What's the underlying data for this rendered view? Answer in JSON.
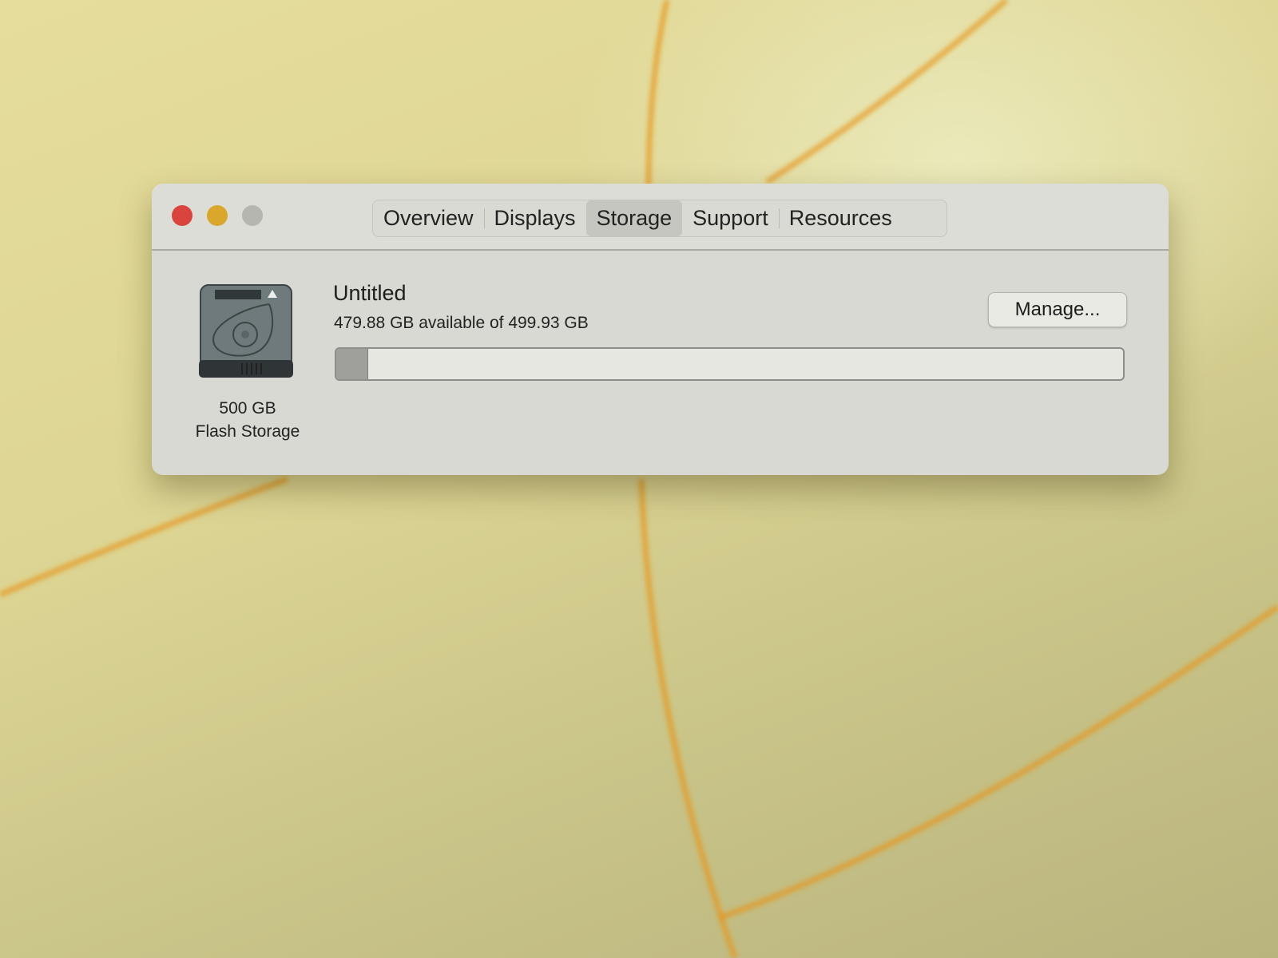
{
  "window": {
    "tabs": [
      {
        "label": "Overview"
      },
      {
        "label": "Displays"
      },
      {
        "label": "Storage",
        "active": true
      },
      {
        "label": "Support"
      },
      {
        "label": "Resources"
      }
    ],
    "disk": {
      "size_label": "500 GB",
      "type_label": "Flash Storage",
      "volume_name": "Untitled",
      "availability": "479.88 GB available of 499.93 GB",
      "used_percent": 4.0,
      "manage_label": "Manage..."
    }
  },
  "colors": {
    "close": "#d9443f",
    "minimize": "#dba62c",
    "zoom": "#b5b6b0"
  }
}
